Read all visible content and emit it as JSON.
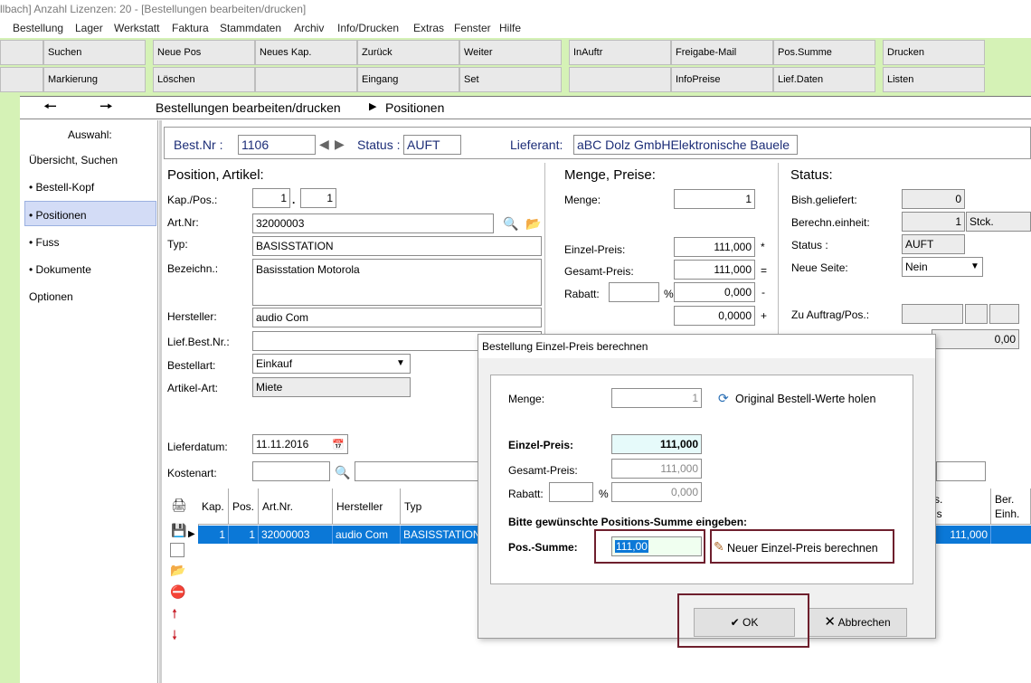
{
  "window": {
    "title": "llbach] Anzahl Lizenzen: 20 - [Bestellungen bearbeiten/drucken]"
  },
  "menu": [
    "Bestellung",
    "Lager",
    "Werkstatt",
    "Faktura",
    "Stammdaten",
    "Archiv",
    "Info/Drucken",
    "Extras",
    "Fenster",
    "Hilfe"
  ],
  "toolbar": {
    "row1": [
      "Suchen",
      "Neue Pos",
      "Neues Kap.",
      "Zurück",
      "Weiter",
      "InAuftr",
      "Freigabe-Mail",
      "Pos.Summe",
      "Drucken"
    ],
    "row2": [
      "Markierung",
      "Löschen",
      "",
      "Eingang",
      "Set",
      "",
      "InfoPreise",
      "Lief.Daten",
      "Listen"
    ]
  },
  "breadcrumb": {
    "part1": "Bestellungen bearbeiten/drucken",
    "part2": "Positionen"
  },
  "sidebar": {
    "heading": "Auswahl:",
    "items": [
      "Übersicht, Suchen",
      "• Bestell-Kopf",
      "• Positionen",
      "• Fuss",
      "• Dokumente",
      "Optionen"
    ]
  },
  "header": {
    "best_nr_label": "Best.Nr :",
    "best_nr": "1106",
    "status_label": "Status :",
    "status": "AUFT",
    "lieferant_label": "Lieferant:",
    "lieferant": "aBC Dolz GmbHElektronische Bauele"
  },
  "position": {
    "title": "Position, Artikel:",
    "kap_pos_label": "Kap./Pos.:",
    "kap": "1",
    "pos": "1",
    "artnr_label": "Art.Nr:",
    "artnr": "32000003",
    "typ_label": "Typ:",
    "typ": "BASISSTATION",
    "bezeichn_label": "Bezeichn.:",
    "bezeichn": "Basisstation Motorola",
    "hersteller_label": "Hersteller:",
    "hersteller": "audio Com",
    "liefbestnr_label": "Lief.Best.Nr.:",
    "liefbestnr": "",
    "bestellart_label": "Bestellart:",
    "bestellart": "Einkauf",
    "artikelart_label": "Artikel-Art:",
    "artikelart": "Miete",
    "lieferdatum_label": "Lieferdatum:",
    "lieferdatum": "11.11.2016",
    "kostenart_label": "Kostenart:"
  },
  "menge": {
    "title": "Menge, Preise:",
    "menge_label": "Menge:",
    "menge": "1",
    "einzelpreis_label": "Einzel-Preis:",
    "einzelpreis": "111,000",
    "op1": "*",
    "gesamtpreis_label": "Gesamt-Preis:",
    "gesamtpreis": "111,000",
    "op2": "=",
    "rabatt_label": "Rabatt:",
    "rabatt_pct_sign": "%",
    "rabatt_value": "0,000",
    "op3": "-",
    "extra_value": "0,0000",
    "op4": "+"
  },
  "status": {
    "title": "Status:",
    "bish_label": "Bish.geliefert:",
    "bish": "0",
    "berechn_label": "Berechn.einheit:",
    "berechn": "1",
    "berechn_unit": "Stck.",
    "status_label": "Status :",
    "status": "AUFT",
    "neue_seite_label": "Neue Seite:",
    "neue_seite": "Nein",
    "zu_auftrag_label": "Zu Auftrag/Pos.:",
    "sum_value": "0,00"
  },
  "grid": {
    "headers": [
      "Kap.",
      "Pos.",
      "Art.Nr.",
      "Hersteller",
      "Typ",
      "s.\nis",
      "Ber.\nEinh."
    ],
    "row": {
      "kap": "1",
      "pos": "1",
      "artnr": "32000003",
      "hersteller": "audio Com",
      "typ": "BASISSTATION",
      "preis": "111,000"
    }
  },
  "dialog": {
    "title": "Bestellung Einzel-Preis berechnen",
    "menge_label": "Menge:",
    "menge": "1",
    "original_label": "Original Bestell-Werte holen",
    "einzelpreis_label": "Einzel-Preis:",
    "einzelpreis": "111,000",
    "gesamtpreis_label": "Gesamt-Preis:",
    "gesamtpreis": "111,000",
    "rabatt_label": "Rabatt:",
    "rabatt_pct_sign": "%",
    "rabatt_value": "0,000",
    "prompt": "Bitte gewünschte Positions-Summe eingeben:",
    "possumme_label": "Pos.-Summe:",
    "possumme": "111,00",
    "neuer_label": "Neuer Einzel-Preis berechnen",
    "ok_label": "OK",
    "cancel_label": "Abbrechen"
  },
  "colors": {
    "toolbar_green": "#d5f2b6",
    "selection_blue": "#0b78d7",
    "highlight": "#6e1f2d",
    "header_blue": "#1c2d77"
  }
}
